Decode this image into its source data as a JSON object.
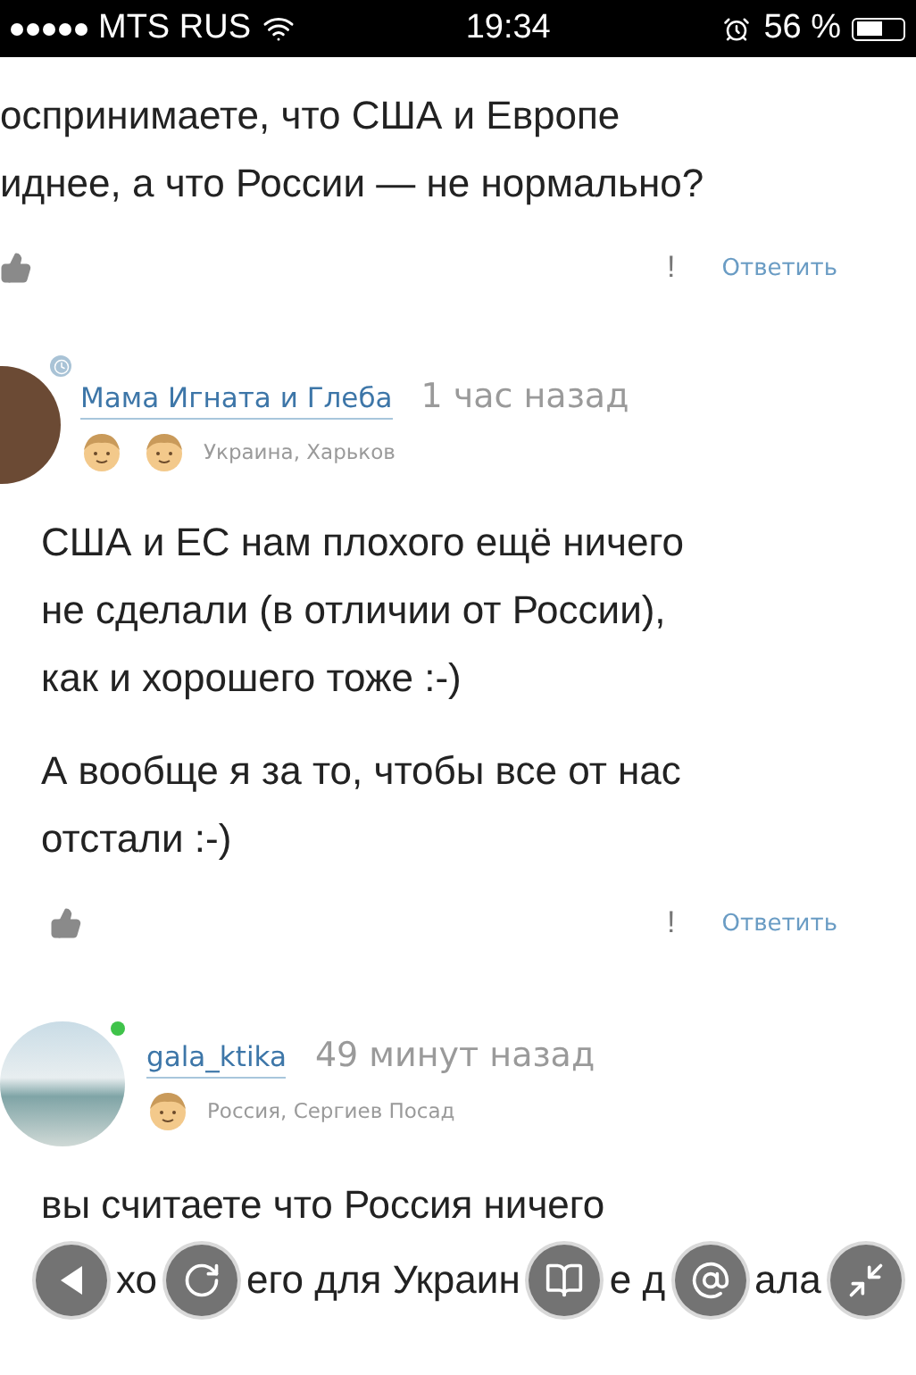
{
  "status_bar": {
    "carrier": "MTS RUS",
    "time": "19:34",
    "battery": "56 %"
  },
  "comments": [
    {
      "kind": "continued",
      "paragraphs": [
        [
          "оспринимаете, что США и Европе",
          "иднее, а что России — не нормально?"
        ]
      ],
      "report": "!",
      "reply": "Ответить"
    },
    {
      "kind": "full",
      "author": "Мама Игната и Глеба",
      "time": "1 час назад",
      "online": false,
      "clock_badge": true,
      "badges": [
        {
          "kind": "boy"
        },
        {
          "kind": "boy"
        }
      ],
      "location": "Украина, Харьков",
      "paragraphs": [
        [
          "США и ЕС нам плохого ещё ничего",
          "не сделали (в отличии от России),",
          "как и хорошего тоже :-)"
        ],
        [
          "А вообще я за то, чтобы все от нас",
          "отстали :-)"
        ]
      ],
      "report": "!",
      "reply": "Ответить"
    },
    {
      "kind": "full",
      "author": "gala_ktika",
      "time": "49 минут назад",
      "online": true,
      "clock_badge": false,
      "badges": [
        {
          "kind": "boy"
        }
      ],
      "location": "Россия, Сергиев Посад",
      "paragraphs": [
        [
          "вы считаете что Россия ничего"
        ]
      ],
      "covered_line": [
        "хо",
        "его для Украин",
        "е д",
        "ала"
      ]
    }
  ]
}
